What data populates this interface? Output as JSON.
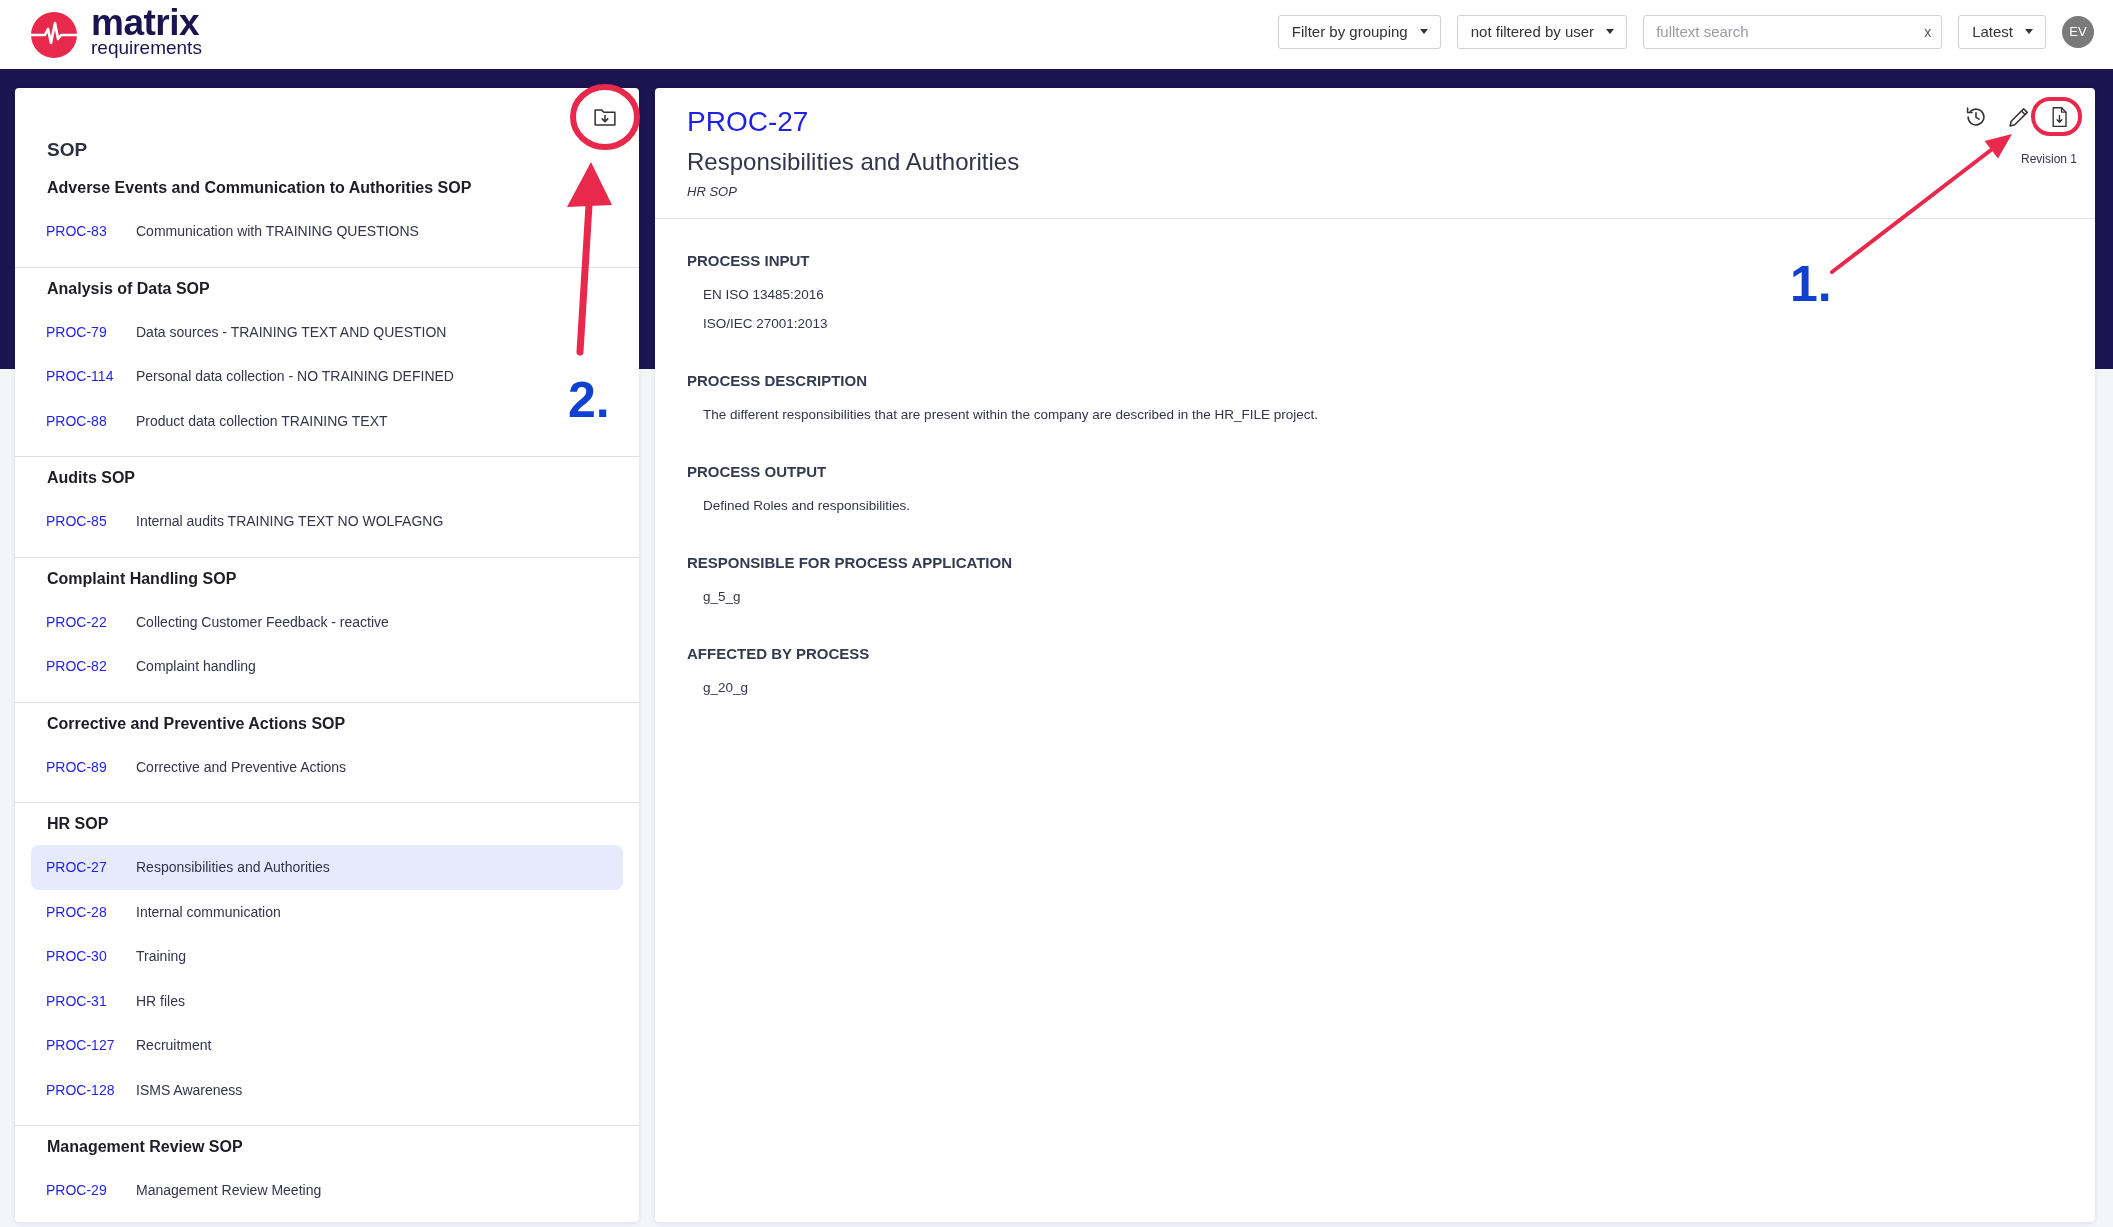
{
  "header": {
    "logo": {
      "wordmark": "matrix",
      "tagline": "requirements"
    },
    "filters": [
      {
        "label": "Filter by grouping"
      },
      {
        "label": "not filtered by user"
      }
    ],
    "search": {
      "placeholder": "fulltext search",
      "clear": "x"
    },
    "version": {
      "label": "Latest"
    },
    "user": {
      "initials": "EV"
    }
  },
  "tree": {
    "title": "SOP",
    "groups": [
      {
        "title": "Adverse Events and Communication to Authorities SOP",
        "items": [
          {
            "id": "PROC-83",
            "title": "Communication with TRAINING QUESTIONS",
            "selected": false
          }
        ]
      },
      {
        "title": "Analysis of Data SOP",
        "items": [
          {
            "id": "PROC-79",
            "title": "Data sources - TRAINING TEXT AND QUESTION",
            "selected": false
          },
          {
            "id": "PROC-114",
            "title": "Personal data collection - NO TRAINING DEFINED",
            "selected": false
          },
          {
            "id": "PROC-88",
            "title": "Product data collection TRAINING TEXT",
            "selected": false
          }
        ]
      },
      {
        "title": "Audits SOP",
        "items": [
          {
            "id": "PROC-85",
            "title": "Internal audits TRAINING TEXT NO WOLFAGNG",
            "selected": false
          }
        ]
      },
      {
        "title": "Complaint Handling SOP",
        "items": [
          {
            "id": "PROC-22",
            "title": "Collecting Customer Feedback - reactive",
            "selected": false
          },
          {
            "id": "PROC-82",
            "title": "Complaint handling",
            "selected": false
          }
        ]
      },
      {
        "title": "Corrective and Preventive Actions SOP",
        "items": [
          {
            "id": "PROC-89",
            "title": "Corrective and Preventive Actions",
            "selected": false
          }
        ]
      },
      {
        "title": "HR SOP",
        "items": [
          {
            "id": "PROC-27",
            "title": "Responsibilities and Authorities",
            "selected": true
          },
          {
            "id": "PROC-28",
            "title": "Internal communication",
            "selected": false
          },
          {
            "id": "PROC-30",
            "title": "Training",
            "selected": false
          },
          {
            "id": "PROC-31",
            "title": "HR files",
            "selected": false
          },
          {
            "id": "PROC-127",
            "title": "Recruitment",
            "selected": false
          },
          {
            "id": "PROC-128",
            "title": "ISMS Awareness",
            "selected": false
          }
        ]
      },
      {
        "title": "Management Review SOP",
        "items": [
          {
            "id": "PROC-29",
            "title": "Management Review Meeting",
            "selected": false
          }
        ]
      }
    ]
  },
  "document": {
    "id": "PROC-27",
    "title": "Responsibilities and Authorities",
    "category": "HR SOP",
    "revision": "Revision 1",
    "sections": [
      {
        "heading": "PROCESS INPUT",
        "values": [
          "EN ISO 13485:2016",
          "ISO/IEC 27001:2013"
        ]
      },
      {
        "heading": "PROCESS DESCRIPTION",
        "values": [
          "The different responsibilities that are present within the company are described in the HR_FILE project."
        ]
      },
      {
        "heading": "PROCESS OUTPUT",
        "values": [
          "Defined Roles and responsibilities."
        ]
      },
      {
        "heading": "RESPONSIBLE FOR PROCESS APPLICATION",
        "values": [
          "g_5_g"
        ]
      },
      {
        "heading": "AFFECTED BY PROCESS",
        "values": [
          "g_20_g"
        ]
      }
    ]
  },
  "annotations": [
    {
      "kind": "document",
      "label": "1."
    },
    {
      "kind": "tree",
      "label": "2."
    }
  ]
}
